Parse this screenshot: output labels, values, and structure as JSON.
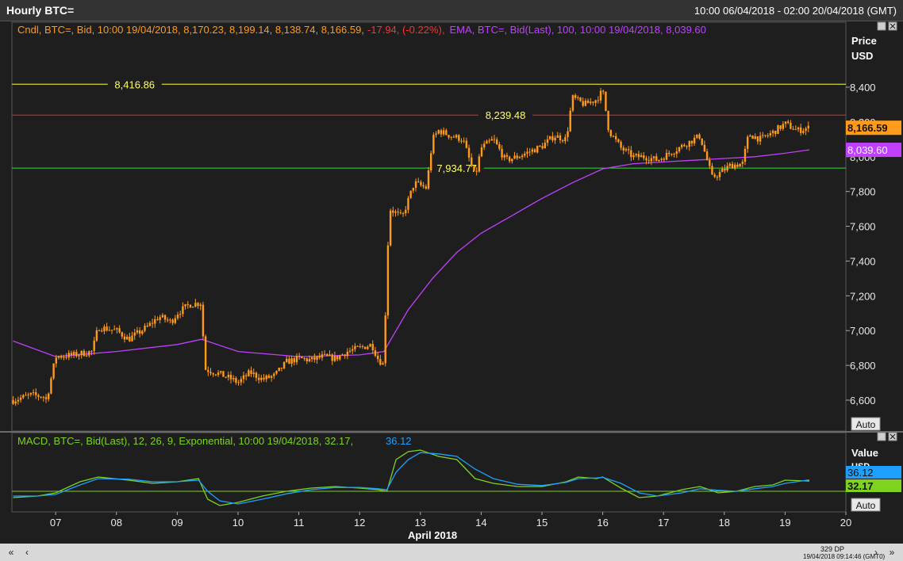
{
  "window": {
    "title": "Hourly BTC=",
    "date_range": "10:00 06/04/2018 - 02:00 20/04/2018 (GMT)"
  },
  "price_panel": {
    "legend_cndl": "Cndl, BTC=, Bid, 10:00 19/04/2018, 8,170.23, 8,199.14, 8,138.74, 8,166.59,",
    "legend_change": "-17.94, (-0.22%),",
    "legend_ema": "EMA, BTC=, Bid(Last), 100, 10:00 19/04/2018, 8,039.60",
    "axis_title": "Price",
    "axis_unit": "USD",
    "auto_label": "Auto",
    "last_price_label": "8,166.59",
    "ema_label": "8,039.60"
  },
  "macd_panel": {
    "legend_text": "MACD, BTC=, Bid(Last), 12, 26, 9, Exponential, 10:00 19/04/2018, 32.17,",
    "legend_signal": "36.12",
    "axis_title": "Value",
    "axis_unit": "USD",
    "signal_label": "36.12",
    "macd_label": "32.17",
    "auto_label": "Auto"
  },
  "x_axis": {
    "ticks": [
      "07",
      "08",
      "09",
      "10",
      "11",
      "12",
      "13",
      "14",
      "15",
      "16",
      "17",
      "18",
      "19",
      "20"
    ],
    "month_label": "April 2018"
  },
  "footer": {
    "dp_count": "329 DP",
    "timestamp": "19/04/2018 09:14:46",
    "tz": "(GMT0)"
  },
  "colors": {
    "candle": "#ff9a1a",
    "ema": "#c040ff",
    "macd": "#7ed321",
    "signal": "#1ea0ff",
    "line_top": "#ffff33",
    "line_mid": "#ff2020",
    "line_low": "#33dd33"
  },
  "chart_data": [
    {
      "type": "candlestick",
      "title": "Hourly BTC=",
      "ylabel": "Price USD",
      "ylim": [
        6500,
        8650
      ],
      "y_ticks": [
        6600,
        6800,
        7000,
        7200,
        7400,
        7600,
        7800,
        8000,
        8200,
        8400
      ],
      "y_tick_labels": [
        "6,600",
        "6,800",
        "7,000",
        "7,200",
        "7,400",
        "7,600",
        "7,800",
        "8,000",
        "8,200",
        "8,400"
      ],
      "xlim": [
        6.28,
        20.0
      ],
      "close_path": {
        "x": [
          6.3,
          6.6,
          6.8,
          6.85,
          7.0,
          7.3,
          7.6,
          7.7,
          8.0,
          8.2,
          8.5,
          8.7,
          8.9,
          9.0,
          9.2,
          9.4,
          9.45,
          9.7,
          9.9,
          10.0,
          10.2,
          10.4,
          10.6,
          10.8,
          11.0,
          11.2,
          11.4,
          11.6,
          11.8,
          12.0,
          12.2,
          12.3,
          12.4,
          12.45,
          12.5,
          12.7,
          12.8,
          12.9,
          13.1,
          13.2,
          13.3,
          13.5,
          13.7,
          13.9,
          14.0,
          14.2,
          14.4,
          14.6,
          14.8,
          15.0,
          15.2,
          15.4,
          15.5,
          15.7,
          15.9,
          16.0,
          16.1,
          16.3,
          16.5,
          16.7,
          16.9,
          17.1,
          17.3,
          17.6,
          17.8,
          17.9,
          18.1,
          18.3,
          18.4,
          18.6,
          18.8,
          19.0,
          19.2,
          19.4
        ],
        "close": [
          6600,
          6630,
          6620,
          6600,
          6850,
          6860,
          6880,
          7020,
          7000,
          6950,
          7020,
          7080,
          7050,
          7100,
          7150,
          7160,
          6780,
          6750,
          6720,
          6700,
          6760,
          6720,
          6740,
          6820,
          6840,
          6830,
          6850,
          6840,
          6880,
          6900,
          6920,
          6840,
          6800,
          7400,
          7700,
          7650,
          7750,
          7850,
          7820,
          8100,
          8150,
          8120,
          8100,
          7880,
          8050,
          8100,
          7980,
          8000,
          8030,
          8060,
          8120,
          8100,
          8340,
          8300,
          8330,
          8380,
          8150,
          8050,
          8000,
          8000,
          7980,
          8020,
          8060,
          8120,
          7880,
          7900,
          7950,
          7960,
          8130,
          8100,
          8140,
          8190,
          8150,
          8166.59
        ]
      },
      "last": {
        "time": "10:00 19/04/2018",
        "open": 8170.23,
        "high": 8199.14,
        "low": 8138.74,
        "close": 8166.59,
        "change": -17.94,
        "change_pct": -0.22
      },
      "horizontal_lines": [
        {
          "value": 8416.86,
          "label": "8,416.86"
        },
        {
          "value": 8239.48,
          "label": "8,239.48"
        },
        {
          "value": 7934.77,
          "label": "7,934.77"
        }
      ]
    },
    {
      "type": "line",
      "series": [
        {
          "name": "EMA, BTC=, Bid(Last), 100",
          "x": [
            6.3,
            7.0,
            8.0,
            9.0,
            9.4,
            10.0,
            11.0,
            12.0,
            12.4,
            12.8,
            13.2,
            13.6,
            14.0,
            14.5,
            15.0,
            15.5,
            16.0,
            16.5,
            17.0,
            17.5,
            18.0,
            18.5,
            19.0,
            19.4
          ],
          "values": [
            6940,
            6850,
            6880,
            6920,
            6950,
            6880,
            6850,
            6860,
            6880,
            7120,
            7300,
            7450,
            7560,
            7660,
            7760,
            7850,
            7930,
            7960,
            7970,
            7980,
            7990,
            8000,
            8020,
            8039.6
          ]
        }
      ]
    },
    {
      "type": "line",
      "title": "MACD",
      "ylabel": "Value USD",
      "ylim": [
        -80,
        160
      ],
      "zero_line": 0,
      "series": [
        {
          "name": "MACD",
          "last_value": 32.17,
          "x": [
            6.3,
            6.7,
            7.0,
            7.4,
            7.7,
            8.2,
            8.6,
            9.0,
            9.35,
            9.5,
            9.7,
            10.0,
            10.4,
            10.8,
            11.2,
            11.6,
            12.0,
            12.3,
            12.45,
            12.6,
            12.8,
            13.0,
            13.3,
            13.6,
            13.9,
            14.2,
            14.6,
            15.0,
            15.4,
            15.6,
            15.9,
            16.0,
            16.3,
            16.6,
            16.9,
            17.3,
            17.6,
            17.9,
            18.2,
            18.5,
            18.8,
            19.0,
            19.4
          ],
          "values": [
            -20,
            -15,
            -5,
            30,
            45,
            35,
            25,
            30,
            40,
            -25,
            -45,
            -35,
            -15,
            0,
            10,
            15,
            10,
            5,
            0,
            100,
            125,
            130,
            110,
            100,
            40,
            25,
            15,
            15,
            30,
            45,
            40,
            45,
            10,
            -20,
            -15,
            5,
            15,
            -5,
            0,
            15,
            20,
            35,
            32.17
          ]
        },
        {
          "name": "Signal",
          "last_value": 36.12,
          "x": [
            6.3,
            6.7,
            7.0,
            7.4,
            7.7,
            8.2,
            8.6,
            9.0,
            9.35,
            9.5,
            9.7,
            10.0,
            10.4,
            10.8,
            11.2,
            11.6,
            12.0,
            12.3,
            12.45,
            12.6,
            12.8,
            13.0,
            13.3,
            13.6,
            13.9,
            14.2,
            14.6,
            15.0,
            15.4,
            15.6,
            15.9,
            16.0,
            16.3,
            16.6,
            16.9,
            17.3,
            17.6,
            17.9,
            18.2,
            18.5,
            18.8,
            19.0,
            19.4
          ],
          "values": [
            -15,
            -15,
            -10,
            20,
            40,
            38,
            30,
            30,
            35,
            0,
            -30,
            -40,
            -25,
            -8,
            5,
            12,
            12,
            8,
            5,
            60,
            100,
            122,
            118,
            110,
            70,
            40,
            22,
            18,
            28,
            40,
            42,
            44,
            25,
            -5,
            -15,
            -5,
            8,
            3,
            0,
            8,
            15,
            25,
            36.12
          ]
        }
      ]
    }
  ]
}
